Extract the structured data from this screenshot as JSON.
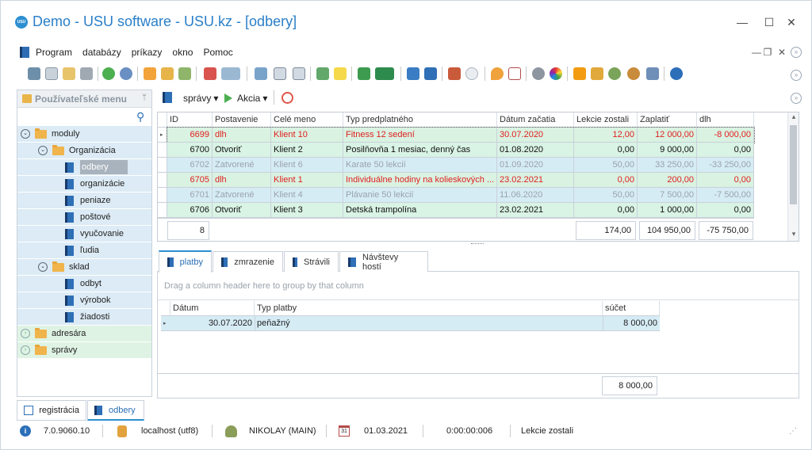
{
  "window": {
    "title": "Demo - USU software - USU.kz - [odbery]",
    "logo_text": "USU",
    "controls": {
      "minimize": "—",
      "maximize": "☐",
      "close": "✕"
    }
  },
  "menu": {
    "items": [
      "Program",
      "databázy",
      "príkazy",
      "okno",
      "Pomoc"
    ],
    "mdi": {
      "minimize": "—",
      "restore": "❐",
      "close": "✕"
    }
  },
  "left_panel": {
    "title": "Používateľské menu",
    "pin": "ᛘ",
    "search_icon": "⚲",
    "tree": [
      {
        "label": "moduly",
        "level": 0,
        "type": "folder",
        "expanded": true
      },
      {
        "label": "Organizácia",
        "level": 1,
        "type": "folder",
        "expanded": true
      },
      {
        "label": "odbery",
        "level": 2,
        "type": "item",
        "selected": true
      },
      {
        "label": "organizácie",
        "level": 2,
        "type": "item"
      },
      {
        "label": "peniaze",
        "level": 2,
        "type": "item"
      },
      {
        "label": "poštové",
        "level": 2,
        "type": "item"
      },
      {
        "label": "vyučovanie",
        "level": 2,
        "type": "item"
      },
      {
        "label": "ľudia",
        "level": 2,
        "type": "item"
      },
      {
        "label": "sklad",
        "level": 1,
        "type": "folder",
        "expanded": true
      },
      {
        "label": "odbyt",
        "level": 2,
        "type": "item"
      },
      {
        "label": "výrobok",
        "level": 2,
        "type": "item"
      },
      {
        "label": "žiadosti",
        "level": 2,
        "type": "item"
      },
      {
        "label": "adresára",
        "level": 0,
        "type": "folder",
        "expanded": false
      },
      {
        "label": "správy",
        "level": 0,
        "type": "folder",
        "expanded": false
      }
    ]
  },
  "right_toolbar": {
    "reports_label": "správy",
    "action_label": "Akcia",
    "dropdown_caret": "▾"
  },
  "grid": {
    "columns": [
      "ID",
      "Postavenie",
      "Celé meno",
      "Typ predplatného",
      "Dátum začatia",
      "Lekcie zostali",
      "Zaplatiť",
      "dlh"
    ],
    "rows": [
      {
        "id": "6699",
        "status": "dlh",
        "name": "Klient 10",
        "type": "Fitness 12 sedení",
        "date": "30.07.2020",
        "lessons": "12,00",
        "pay": "12 000,00",
        "debt": "-8 000,00",
        "style": "debt",
        "current": true
      },
      {
        "id": "6700",
        "status": "Otvoriť",
        "name": "Klient 2",
        "type": "Posilňovňa 1 mesiac, denný čas",
        "date": "01.08.2020",
        "lessons": "0,00",
        "pay": "9 000,00",
        "debt": "0,00",
        "style": "open"
      },
      {
        "id": "6702",
        "status": "Zatvorené",
        "name": "Klient 6",
        "type": "Karate 50 lekcií",
        "date": "01.09.2020",
        "lessons": "50,00",
        "pay": "33 250,00",
        "debt": "-33 250,00",
        "style": "closed"
      },
      {
        "id": "6705",
        "status": "dlh",
        "name": "Klient 1",
        "type": "Individuálne hodiny na kolieskových ...",
        "date": "23.02.2021",
        "lessons": "0,00",
        "pay": "200,00",
        "debt": "0,00",
        "style": "debt2"
      },
      {
        "id": "6701",
        "status": "Zatvorené",
        "name": "Klient 4",
        "type": "Plávanie 50 lekcií",
        "date": "11.06.2020",
        "lessons": "50,00",
        "pay": "7 500,00",
        "debt": "-7 500,00",
        "style": "closed"
      },
      {
        "id": "6706",
        "status": "Otvoriť",
        "name": "Klient 3",
        "type": "Detská trampolína",
        "date": "23.02.2021",
        "lessons": "0,00",
        "pay": "1 000,00",
        "debt": "0,00",
        "style": "open"
      }
    ],
    "footer": {
      "count": "8",
      "lessons_total": "174,00",
      "pay_total": "104 950,00",
      "debt_total": "-75 750,00"
    },
    "scroll_up": "▴",
    "scroll_down": "▾"
  },
  "tabs": [
    "platby",
    "zmrazenie",
    "Strávili",
    "Návštevy hostí"
  ],
  "detail": {
    "group_hint": "Drag a column header here to group by that column",
    "columns": [
      "Dátum",
      "Typ platby",
      "súčet"
    ],
    "rows": [
      {
        "date": "30.07.2020",
        "type": "peňažný",
        "sum": "8 000,00"
      }
    ],
    "total": "8 000,00"
  },
  "bottom_tabs": [
    "registrácia",
    "odbery"
  ],
  "statusbar": {
    "version": "7.0.9060.10",
    "server": "localhost (utf8)",
    "user": "NIKOLAY (MAIN)",
    "date": "01.03.2021",
    "timer": "0:00:00:006",
    "field": "Lekcie zostali",
    "calendar_day": "31"
  },
  "colors": {
    "accent": "#2c8fd1",
    "row_debt_bg": "#d9f2e1",
    "row_open_bg": "#d9f3e4",
    "row_closed_bg": "#d6ecf5",
    "debt_text": "#e02020",
    "closed_text": "#9aa3ab",
    "tree_bg": "#dcebf5",
    "tree_folder_bg": "#dff3e4"
  }
}
